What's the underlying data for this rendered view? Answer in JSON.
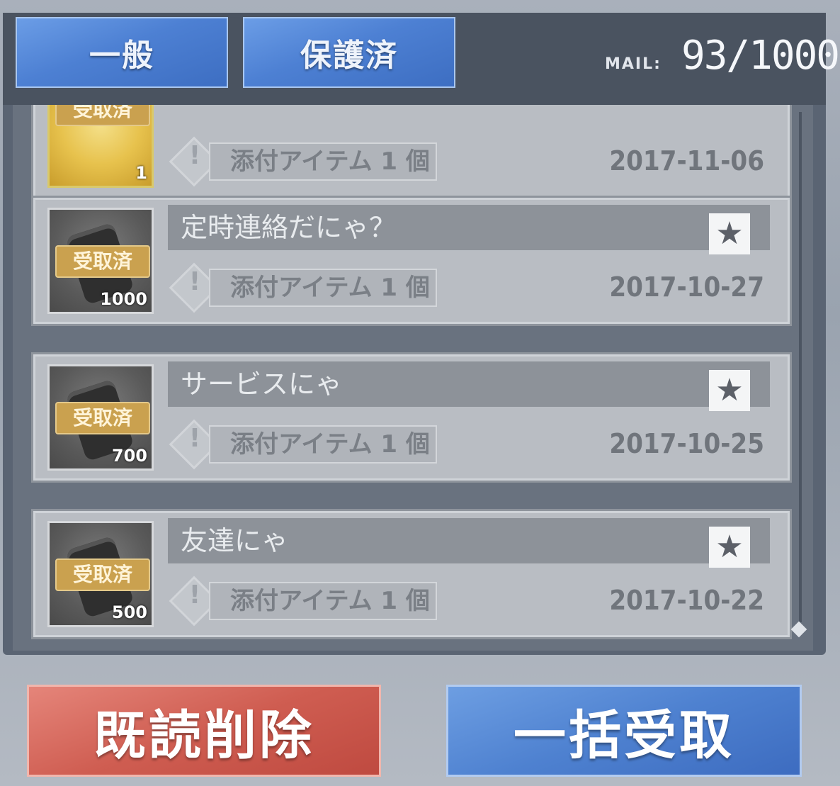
{
  "tabs": {
    "general": "一般",
    "protected": "保護済"
  },
  "mail": {
    "label": "MAIL:",
    "count": "93/1000"
  },
  "mails": [
    {
      "title": "",
      "badge": "受取済",
      "quantity": "1",
      "attachment": "添付アイテム 1 個",
      "date": "2017-11-06",
      "star": "☆"
    },
    {
      "title": "定時連絡だにゃ？",
      "badge": "受取済",
      "quantity": "1000",
      "attachment": "添付アイテム 1 個",
      "date": "2017-10-27",
      "star": "★"
    },
    {
      "title": "サービスにゃ",
      "badge": "受取済",
      "quantity": "700",
      "attachment": "添付アイテム 1 個",
      "date": "2017-10-25",
      "star": "★"
    },
    {
      "title": "友達にゃ",
      "badge": "受取済",
      "quantity": "500",
      "attachment": "添付アイテム 1 個",
      "date": "2017-10-22",
      "star": "★"
    }
  ],
  "buttons": {
    "delete_read": "既読削除",
    "receive_all": "一括受取"
  },
  "colors": {
    "tab_blue": "#4d80d3",
    "delete_red": "#cf5d51",
    "receive_blue": "#4e81d0",
    "badge_gold": "#caa14f"
  }
}
